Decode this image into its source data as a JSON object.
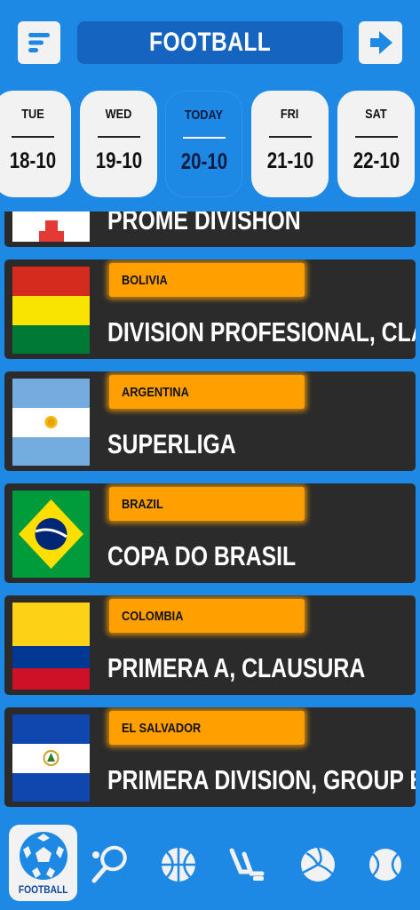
{
  "header": {
    "title": "FOOTBALL",
    "menu_icon": "menu-lines-icon",
    "next_icon": "arrow-right-icon"
  },
  "dates": [
    {
      "day": "TUE",
      "date": "18-10",
      "active": false
    },
    {
      "day": "WED",
      "date": "19-10",
      "active": false
    },
    {
      "day": "TODAY",
      "date": "20-10",
      "active": true
    },
    {
      "day": "FRI",
      "date": "21-10",
      "active": false
    },
    {
      "day": "SAT",
      "date": "22-10",
      "active": false
    }
  ],
  "leagues": [
    {
      "country": "",
      "name": "PROME DIVISHON",
      "flag": "partial-red-white"
    },
    {
      "country": "BOLIVIA",
      "name": "DIVISION PROFESIONAL, CLAUSURA",
      "flag": "bolivia"
    },
    {
      "country": "ARGENTINA",
      "name": "SUPERLIGA",
      "flag": "argentina"
    },
    {
      "country": "BRAZIL",
      "name": "COPA DO BRASIL",
      "flag": "brazil"
    },
    {
      "country": "COLOMBIA",
      "name": "PRIMERA A, CLAUSURA",
      "flag": "colombia"
    },
    {
      "country": "EL SALVADOR",
      "name": "PRIMERA DIVISION, GROUP B",
      "flag": "el-salvador"
    }
  ],
  "bottom_nav": {
    "active_label": "FOOTBALL",
    "items": [
      "football-icon",
      "tennis-icon",
      "basketball-icon",
      "hockey-icon",
      "volleyball-icon",
      "tennis-ball-icon"
    ]
  },
  "colors": {
    "background": "#1e88e5",
    "header_title_bg": "#1565c0",
    "card_bg": "#2b2b2b",
    "country_tag": "#ffa000"
  }
}
